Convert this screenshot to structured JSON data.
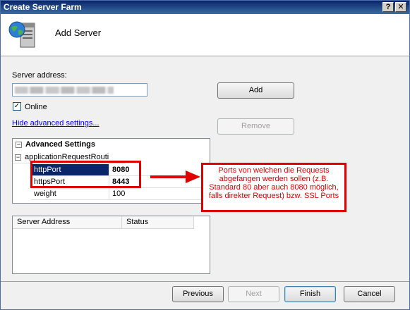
{
  "window": {
    "title": "Create Server Farm",
    "help_glyph": "?",
    "close_glyph": "✕"
  },
  "header": {
    "title": "Add Server"
  },
  "form": {
    "server_address_label": "Server address:",
    "server_address_value": "",
    "online_label": "Online",
    "online_checked": true,
    "online_check_glyph": "✓",
    "hide_advanced_link": "Hide advanced settings...",
    "add_button": "Add",
    "remove_button": "Remove"
  },
  "advanced": {
    "group_label": "Advanced Settings",
    "collapse_glyph": "−",
    "section_label": "applicationRequestRouti",
    "rows": [
      {
        "name": "httpPort",
        "value": "8080"
      },
      {
        "name": "httpsPort",
        "value": "8443"
      },
      {
        "name": "weight",
        "value": "100"
      }
    ]
  },
  "annotation": {
    "text": "Ports von welchen die Requests abgefangen werden sollen (z.B. Standard 80 aber auch 8080 möglich, falls direkter Request) bzw. SSL Ports",
    "color": "#e00000"
  },
  "server_list": {
    "columns": [
      "Server Address",
      "Status"
    ]
  },
  "footer": {
    "previous": "Previous",
    "next": "Next",
    "finish": "Finish",
    "cancel": "Cancel"
  },
  "colors": {
    "selection": "#0a246a",
    "titlebar": "#0a246a",
    "link": "#0000ee"
  }
}
